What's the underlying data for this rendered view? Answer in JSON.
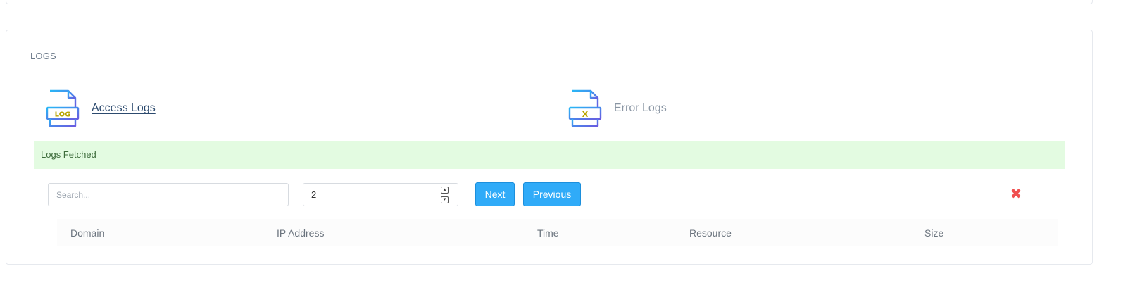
{
  "logs": {
    "title": "LOGS",
    "access_label": "Access Logs",
    "access_icon_text": "LOG",
    "error_label": "Error Logs",
    "error_icon_text": "X",
    "alert_text": "Logs Fetched",
    "search_placeholder": "Search...",
    "page_value": "2",
    "next_label": "Next",
    "previous_label": "Previous",
    "close_glyph": "✖",
    "columns": [
      "Domain",
      "IP Address",
      "Time",
      "Resource",
      "Size"
    ]
  },
  "colors": {
    "button": "#30abf8",
    "alert_bg": "#e3fbe1",
    "alert_text": "#3c6b3a",
    "close": "#f05050",
    "icon_gradient_start": "#29b6f6",
    "icon_gradient_end": "#6a5ae0",
    "icon_badge_text": "#b8a400"
  }
}
